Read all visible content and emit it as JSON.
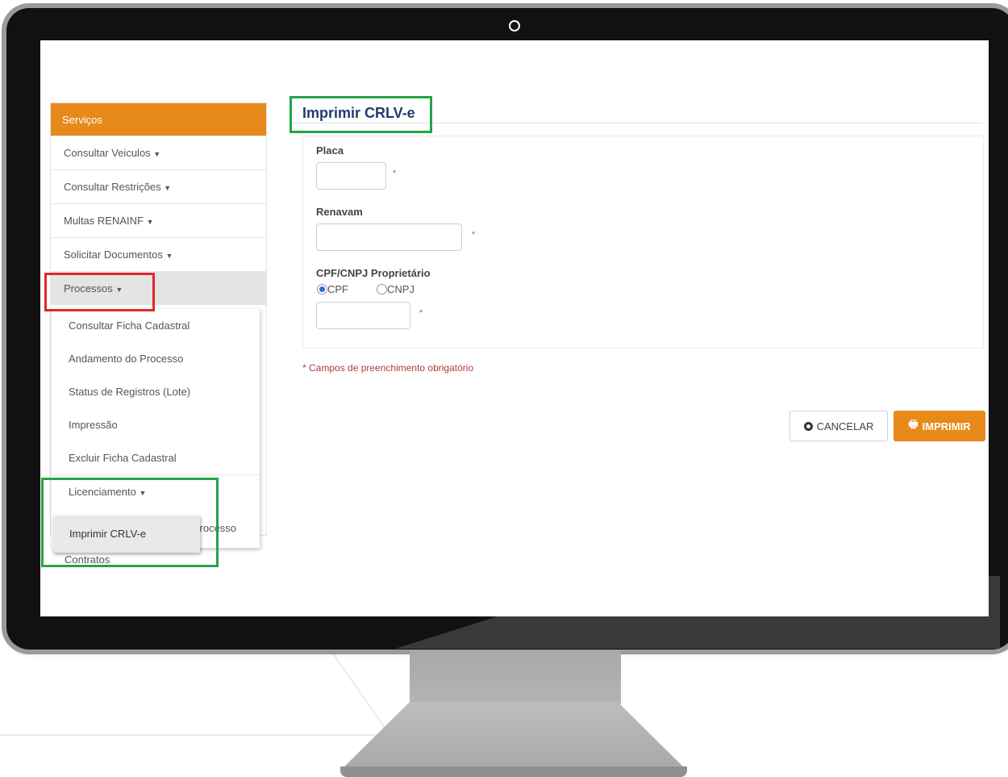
{
  "sidebar": {
    "header": "Serviços",
    "items": [
      {
        "label": "Consultar Veiculos"
      },
      {
        "label": "Consultar Restrições"
      },
      {
        "label": "Multas RENAINF"
      },
      {
        "label": "Solicitar Documentos"
      },
      {
        "label": "Processos"
      }
    ],
    "submenu": [
      {
        "label": "Consultar Ficha Cadastral"
      },
      {
        "label": "Andamento do Processo"
      },
      {
        "label": "Status de Registros (Lote)"
      },
      {
        "label": "Impressão"
      },
      {
        "label": "Excluir Ficha Cadastral"
      },
      {
        "label": "Licenciamento"
      }
    ],
    "hidden_item_fragment": "o Processo",
    "flyout_item": "Imprimir CRLV-e",
    "partial_item": "Contratos"
  },
  "form": {
    "title": "Imprimir CRLV-e",
    "placa_label": "Placa",
    "renavam_label": "Renavam",
    "cpf_cnpj_label": "CPF/CNPJ Proprietário",
    "radio_cpf": "CPF",
    "radio_cnpj": "CNPJ",
    "required_mark": "*",
    "required_note": "* Campos de preenchimento obrigatório",
    "cancel_button": "CANCELAR",
    "print_button": "IMPRIMIR"
  },
  "colors": {
    "accent_orange": "#e8891b",
    "title_blue": "#1d3e6c",
    "highlight_red": "#e2262e",
    "highlight_green": "#22a447"
  }
}
